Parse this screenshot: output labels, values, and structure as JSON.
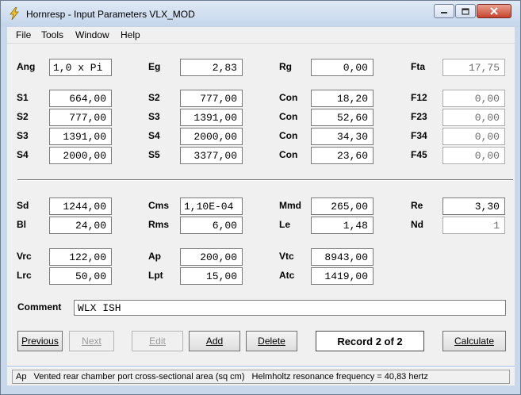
{
  "window": {
    "title": "Hornresp - Input Parameters   VLX_MOD"
  },
  "menu": [
    "File",
    "Tools",
    "Window",
    "Help"
  ],
  "row0": {
    "ang_label": "Ang",
    "ang_value": "1,0 x Pi",
    "eg_label": "Eg",
    "eg_value": "2,83",
    "rg_label": "Rg",
    "rg_value": "0,00",
    "fta_label": "Fta",
    "fta_value": "17,75"
  },
  "horn": {
    "s1_label": "S1",
    "s1": "664,00",
    "s2_label": "S2",
    "s2": "777,00",
    "s3_label": "S3",
    "s3": "1391,00",
    "s4_label": "S4",
    "s4": "2000,00",
    "s2b_label": "S2",
    "s2b": "777,00",
    "s3b_label": "S3",
    "s3b": "1391,00",
    "s4b_label": "S4",
    "s4b": "2000,00",
    "s5_label": "S5",
    "s5": "3377,00",
    "con_label": "Con",
    "con1": "18,20",
    "con2": "52,60",
    "con3": "34,30",
    "con4": "23,60",
    "f12_label": "F12",
    "f12": "0,00",
    "f23_label": "F23",
    "f23": "0,00",
    "f34_label": "F34",
    "f34": "0,00",
    "f45_label": "F45",
    "f45": "0,00"
  },
  "driver": {
    "sd_label": "Sd",
    "sd": "1244,00",
    "bl_label": "Bl",
    "bl": "24,00",
    "cms_label": "Cms",
    "cms": "1,10E-04",
    "rms_label": "Rms",
    "rms": "6,00",
    "mmd_label": "Mmd",
    "mmd": "265,00",
    "le_label": "Le",
    "le": "1,48",
    "re_label": "Re",
    "re": "3,30",
    "nd_label": "Nd",
    "nd": "1"
  },
  "chamber": {
    "vrc_label": "Vrc",
    "vrc": "122,00",
    "lrc_label": "Lrc",
    "lrc": "50,00",
    "ap_label": "Ap",
    "ap": "200,00",
    "lpt_label": "Lpt",
    "lpt": "15,00",
    "vtc_label": "Vtc",
    "vtc": "8943,00",
    "atc_label": "Atc",
    "atc": "1419,00"
  },
  "comment": {
    "label": "Comment",
    "value": "WLX ISH"
  },
  "buttons": {
    "previous": "Previous",
    "next": "Next",
    "edit": "Edit",
    "add": "Add",
    "delete": "Delete",
    "calculate": "Calculate"
  },
  "record": "Record 2 of 2",
  "status": {
    "field": "Ap",
    "description": "Vented rear chamber port cross-sectional area  (sq cm)",
    "helmholtz": "Helmholtz resonance frequency = 40,83 hertz"
  }
}
